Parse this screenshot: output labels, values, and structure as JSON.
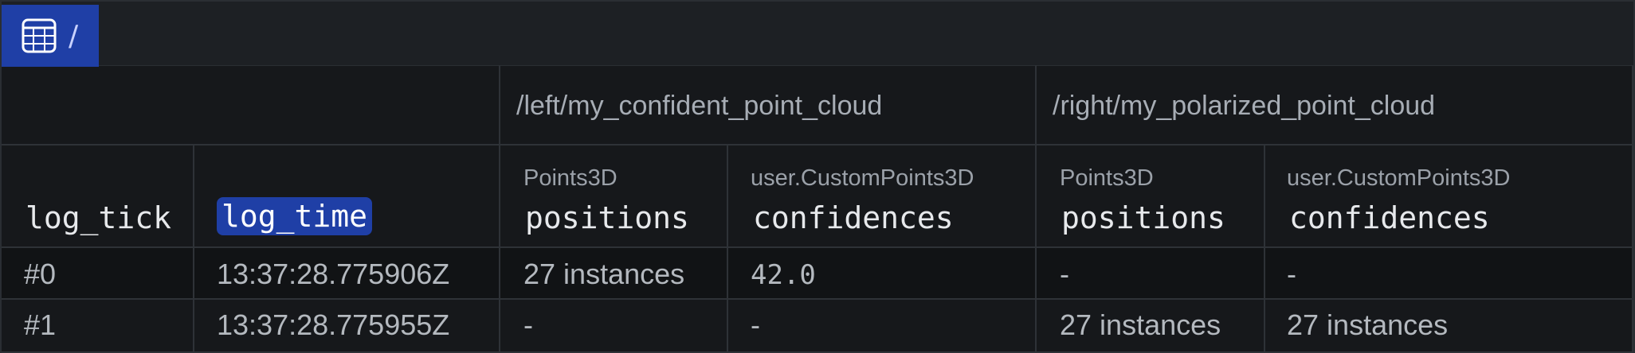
{
  "tab": {
    "path": "/",
    "icon": "table-icon"
  },
  "entities": [
    {
      "path": "/left/my_confident_point_cloud"
    },
    {
      "path": "/right/my_polarized_point_cloud"
    }
  ],
  "columns": [
    {
      "archetype": "",
      "name": "log_tick"
    },
    {
      "archetype": "",
      "name": "log_time"
    },
    {
      "archetype": "Points3D",
      "name": "positions"
    },
    {
      "archetype": "user.CustomPoints3D",
      "name": "confidences"
    },
    {
      "archetype": "Points3D",
      "name": "positions"
    },
    {
      "archetype": "user.CustomPoints3D",
      "name": "confidences"
    }
  ],
  "rows": [
    [
      "#0",
      "13:37:28.775906Z",
      "27 instances",
      "42.0",
      "-",
      "-"
    ],
    [
      "#1",
      "13:37:28.775955Z",
      "-",
      "-",
      "27 instances",
      "27 instances"
    ]
  ],
  "colors": {
    "accent": "#1f3fa6",
    "background": "#16181b",
    "border": "#2e3237"
  }
}
